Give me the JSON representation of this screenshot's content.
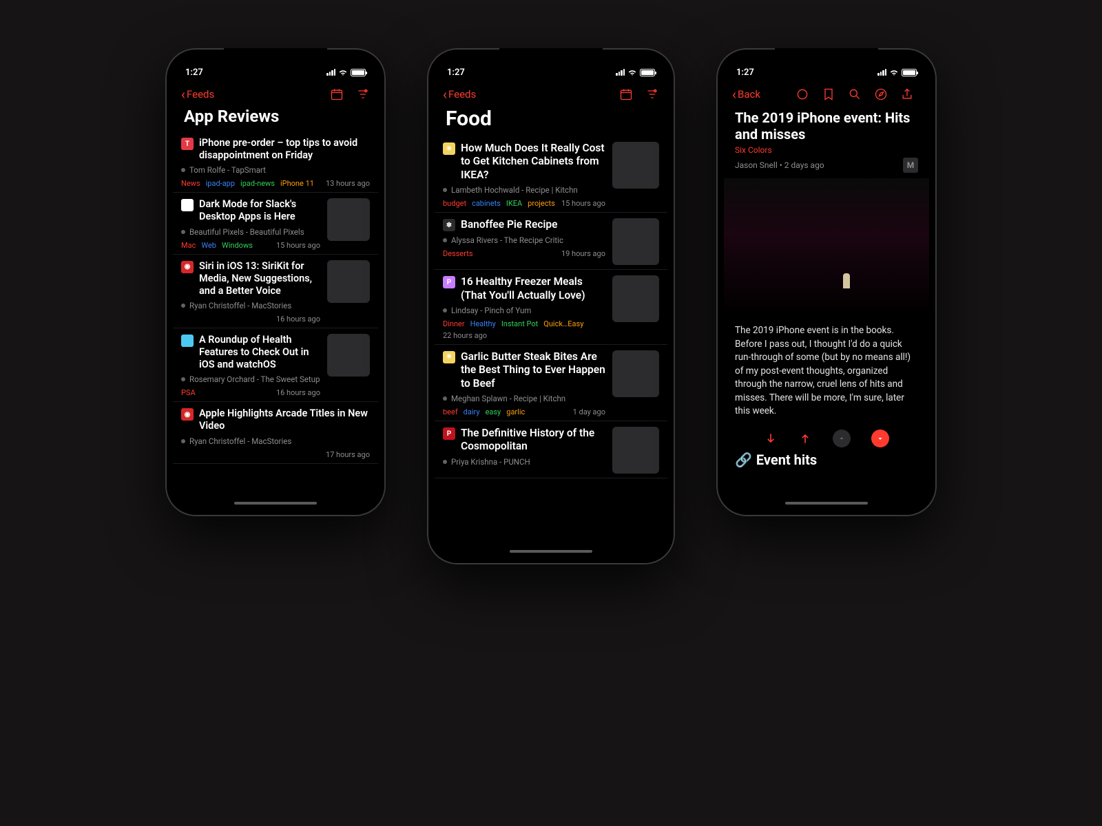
{
  "status": {
    "time": "1:27"
  },
  "accent": "#ff3b30",
  "tag_colors": [
    "#ff3b30",
    "#3a82f7",
    "#30d158",
    "#ff9f0a",
    "#bf5af2",
    "#5ac8fa",
    "#ffd60a"
  ],
  "phone1": {
    "back_label": "Feeds",
    "title": "App Reviews",
    "items": [
      {
        "favicon_bg": "#e63946",
        "favicon_txt": "T",
        "title": "iPhone pre-order – top tips to avoid disappointment on Friday",
        "author": "Tom Rolfe",
        "source": "TapSmart",
        "tags": [
          "News",
          "ipad-app",
          "ipad-news",
          "iPhone 11"
        ],
        "ts": "13 hours ago",
        "thumb": false
      },
      {
        "favicon_bg": "#ffffff",
        "favicon_txt": "",
        "title": "Dark Mode for Slack's Desktop Apps is Here",
        "author": "Beautiful Pixels",
        "source": "Beautiful Pixels",
        "tags": [
          "Mac",
          "Web",
          "Windows"
        ],
        "ts": "15 hours ago",
        "thumb": true
      },
      {
        "favicon_bg": "#d62828",
        "favicon_txt": "◉",
        "title": "Siri in iOS 13: SiriKit for Media, New Suggestions, and a Better Voice",
        "author": "Ryan Christoffel",
        "source": "MacStories",
        "tags": [],
        "ts": "16 hours ago",
        "thumb": true
      },
      {
        "favicon_bg": "#4cc9f0",
        "favicon_txt": "",
        "title": "A Roundup of Health Features to Check Out in iOS and watchOS",
        "author": "Rosemary Orchard",
        "source": "The Sweet Setup",
        "tags": [
          "PSA"
        ],
        "ts": "16 hours ago",
        "thumb": true
      },
      {
        "favicon_bg": "#d62828",
        "favicon_txt": "◉",
        "title": "Apple Highlights Arcade Titles in New Video",
        "author": "Ryan Christoffel",
        "source": "MacStories",
        "tags": [],
        "ts": "17 hours ago",
        "thumb": false
      }
    ]
  },
  "phone2": {
    "back_label": "Feeds",
    "title": "Food",
    "items": [
      {
        "favicon_bg": "#f4d35e",
        "favicon_txt": "✳",
        "title": "How Much Does It Really Cost to Get Kitchen Cabinets from IKEA?",
        "author": "Lambeth Hochwald",
        "source": "Recipe | Kitchn",
        "tags": [
          "budget",
          "cabinets",
          "IKEA",
          "projects"
        ],
        "ts": "15 hours ago",
        "thumb": true
      },
      {
        "favicon_bg": "#2b2b2b",
        "favicon_txt": "❄",
        "title": "Banoffee Pie Recipe",
        "author": "Alyssa Rivers",
        "source": "The Recipe Critic",
        "tags": [
          "Desserts"
        ],
        "ts": "19 hours ago",
        "thumb": true
      },
      {
        "favicon_bg": "#c77dff",
        "favicon_txt": "P",
        "title": "16 Healthy Freezer Meals (That You'll Actually Love)",
        "author": "Lindsay",
        "source": "Pinch of Yum",
        "tags": [
          "Dinner",
          "Healthy",
          "Instant Pot",
          "Quick…Easy"
        ],
        "ts": "22 hours ago",
        "thumb": true
      },
      {
        "favicon_bg": "#f4d35e",
        "favicon_txt": "✳",
        "title": "Garlic Butter Steak Bites Are the Best Thing to Ever Happen to Beef",
        "author": "Meghan Splawn",
        "source": "Recipe | Kitchn",
        "tags": [
          "beef",
          "dairy",
          "easy",
          "garlic"
        ],
        "ts": "1 day ago",
        "thumb": true
      },
      {
        "favicon_bg": "#c1121f",
        "favicon_txt": "P",
        "title": "The Definitive History of the Cosmopolitan",
        "author": "Priya Krishna",
        "source": "PUNCH",
        "tags": [],
        "ts": "",
        "thumb": true
      }
    ]
  },
  "phone3": {
    "back_label": "Back",
    "title": "The 2019 iPhone event: Hits and misses",
    "source": "Six Colors",
    "author": "Jason Snell",
    "date": "2 days ago",
    "body": "The 2019 iPhone event is in the books. Before I pass out, I thought I'd do a quick run-through of some (but by no means all!) of my post-event thoughts, organized through the narrow, cruel lens of hits and misses. There will be more, I'm sure, later this week.",
    "subhead": "Event hits",
    "badge": "M"
  }
}
